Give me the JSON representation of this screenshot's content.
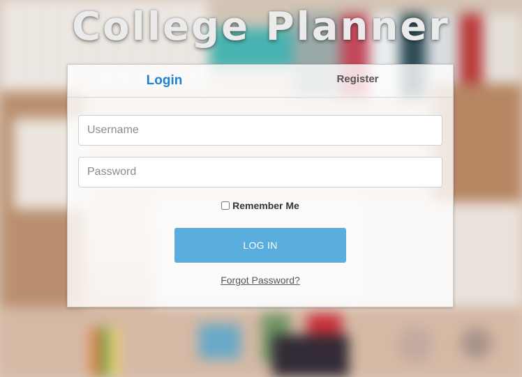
{
  "app": {
    "title": "College Planner"
  },
  "tabs": [
    {
      "label": "Login",
      "active": true
    },
    {
      "label": "Register",
      "active": false
    }
  ],
  "form": {
    "username": {
      "placeholder": "Username",
      "value": ""
    },
    "password": {
      "placeholder": "Password",
      "value": ""
    },
    "remember_label": "Remember Me",
    "remember_checked": false,
    "submit_label": "LOG IN",
    "forgot_label": "Forgot Password?"
  },
  "colors": {
    "accent": "#1f7fd6",
    "button": "#5aaede"
  }
}
